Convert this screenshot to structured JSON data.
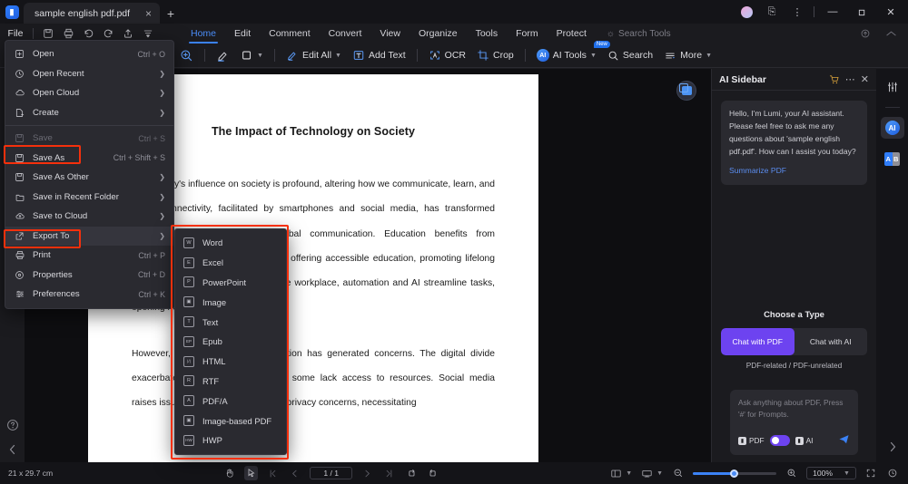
{
  "window": {
    "tab_title": "sample english pdf.pdf",
    "new_tab_label": "+",
    "close_tab_label": "×",
    "minimize_label": "—",
    "maximize_label": "❐",
    "close_label": "✕",
    "more_label": "⋮"
  },
  "menubar": {
    "file_label": "File",
    "quick_actions": [
      "save-icon",
      "print-icon",
      "undo-icon",
      "redo-icon",
      "share-icon",
      "customize-icon"
    ],
    "ribbon_tabs": [
      {
        "label": "Home",
        "active": true
      },
      {
        "label": "Edit",
        "active": false
      },
      {
        "label": "Comment",
        "active": false
      },
      {
        "label": "Convert",
        "active": false
      },
      {
        "label": "View",
        "active": false
      },
      {
        "label": "Organize",
        "active": false
      },
      {
        "label": "Tools",
        "active": false
      },
      {
        "label": "Form",
        "active": false
      },
      {
        "label": "Protect",
        "active": false
      }
    ],
    "search_tools_label": "Search Tools"
  },
  "toolbar": {
    "zoom_label": "",
    "highlight_label": "",
    "shape_label": "",
    "edit_all_label": "Edit All",
    "add_text_label": "Add Text",
    "ocr_label": "OCR",
    "crop_label": "Crop",
    "ai_tools_label": "AI Tools",
    "ai_badge": "New",
    "search_label": "Search",
    "more_label": "More"
  },
  "file_menu": {
    "items": [
      {
        "label": "Open",
        "shortcut": "Ctrl + O",
        "icon": "open-icon",
        "arrow": false,
        "disabled": false,
        "highlighted": false
      },
      {
        "label": "Open Recent",
        "shortcut": "",
        "icon": "clock-icon",
        "arrow": true,
        "disabled": false,
        "highlighted": false
      },
      {
        "label": "Open Cloud",
        "shortcut": "",
        "icon": "cloud-icon",
        "arrow": true,
        "disabled": false,
        "highlighted": false
      },
      {
        "label": "Create",
        "shortcut": "",
        "icon": "create-icon",
        "arrow": true,
        "disabled": false,
        "highlighted": false
      },
      {
        "separator": true
      },
      {
        "label": "Save",
        "shortcut": "Ctrl + S",
        "icon": "save-icon",
        "arrow": false,
        "disabled": true,
        "highlighted": false
      },
      {
        "label": "Save As",
        "shortcut": "Ctrl + Shift + S",
        "icon": "save-as-icon",
        "arrow": false,
        "disabled": false,
        "highlighted": false
      },
      {
        "label": "Save As Other",
        "shortcut": "",
        "icon": "save-other-icon",
        "arrow": true,
        "disabled": false,
        "highlighted": false
      },
      {
        "label": "Save in Recent Folder",
        "shortcut": "",
        "icon": "folder-icon",
        "arrow": true,
        "disabled": false,
        "highlighted": false
      },
      {
        "label": "Save to Cloud",
        "shortcut": "",
        "icon": "cloud-upload-icon",
        "arrow": true,
        "disabled": false,
        "highlighted": false
      },
      {
        "label": "Export To",
        "shortcut": "",
        "icon": "export-icon",
        "arrow": true,
        "disabled": false,
        "highlighted": true
      },
      {
        "label": "Print",
        "shortcut": "Ctrl + P",
        "icon": "print-icon",
        "arrow": false,
        "disabled": false,
        "highlighted": false
      },
      {
        "label": "Properties",
        "shortcut": "Ctrl + D",
        "icon": "properties-icon",
        "arrow": false,
        "disabled": false,
        "highlighted": false
      },
      {
        "label": "Preferences",
        "shortcut": "Ctrl + K",
        "icon": "preferences-icon",
        "arrow": false,
        "disabled": false,
        "highlighted": false
      }
    ]
  },
  "export_submenu": {
    "items": [
      {
        "label": "Word",
        "icon_text": "W"
      },
      {
        "label": "Excel",
        "icon_text": "E"
      },
      {
        "label": "PowerPoint",
        "icon_text": "P"
      },
      {
        "label": "Image",
        "icon_text": "▣"
      },
      {
        "label": "Text",
        "icon_text": "T"
      },
      {
        "label": "Epub",
        "icon_text": "EP"
      },
      {
        "label": "HTML",
        "icon_text": "〈〉"
      },
      {
        "label": "RTF",
        "icon_text": "R"
      },
      {
        "label": "PDF/A",
        "icon_text": "A"
      },
      {
        "label": "Image-based PDF",
        "icon_text": "▣"
      },
      {
        "label": "HWP",
        "icon_text": "HW"
      }
    ]
  },
  "document": {
    "title": "The Impact of Technology on Society",
    "paragraphs": [
      "Technology's influence on society is profound, altering how we communicate, learn, and work. Connectivity, facilitated by smartphones and social media, has transformed relationships, enabling instant global communication. Education benefits from technology, with e-learning platforms offering accessible education, promoting lifelong learning and skill development. In the workplace, automation and AI streamline tasks, opening new job opportunities.",
      "However, technology's rapid integration has generated concerns. The digital divide exacerbates existing inequalities as some lack access to resources. Social media raises issues like misinformation and privacy concerns, necessitating"
    ]
  },
  "ai_sidebar": {
    "title": "AI Sidebar",
    "cart_icon": "cart-icon",
    "more_icon": "more-icon",
    "close_icon": "close-icon",
    "greeting": "Hello, I'm Lumi, your AI assistant. Please feel free to ask me any questions about 'sample english pdf.pdf'. How can I assist you today?",
    "summarize_link": "Summarize PDF",
    "choose_title": "Choose a Type",
    "chat_with_pdf": "Chat with PDF",
    "chat_with_ai": "Chat with AI",
    "type_caption": "PDF-related / PDF-unrelated",
    "composer_placeholder": "Ask anything about PDF, Press '#' for Prompts.",
    "chip_pdf": "PDF",
    "chip_ai": "AI",
    "accent_color": "#6d43f0"
  },
  "right_rail": {
    "items": [
      "sliders-icon",
      "ai-icon",
      "translate-icon"
    ],
    "collapse_icon": "chevron-right-icon"
  },
  "left_rail": {
    "help_icon": "help-icon",
    "collapse_icon": "chevron-left-icon"
  },
  "statusbar": {
    "dimensions": "21 x 29.7 cm",
    "hand_tool": "hand-icon",
    "select_tool": "select-icon",
    "first_page": "❘◀",
    "prev_page": "‹",
    "page_indicator": "1 / 1",
    "next_page": "›",
    "last_page": "▶❘",
    "rotate_left": "rotate-left-icon",
    "rotate_right": "rotate-right-icon",
    "page_layout": "layout-icon",
    "view_mode": "view-mode-icon",
    "zoom_out": "zoom-out-icon",
    "zoom_in": "zoom-in-icon",
    "zoom_value": "100%",
    "fullscreen": "fullscreen-icon",
    "more": "more-icon"
  },
  "annotations": {
    "highlight_color": "#f5300c",
    "boxes": [
      "save-as-item",
      "export-to-item",
      "export-submenu"
    ]
  }
}
